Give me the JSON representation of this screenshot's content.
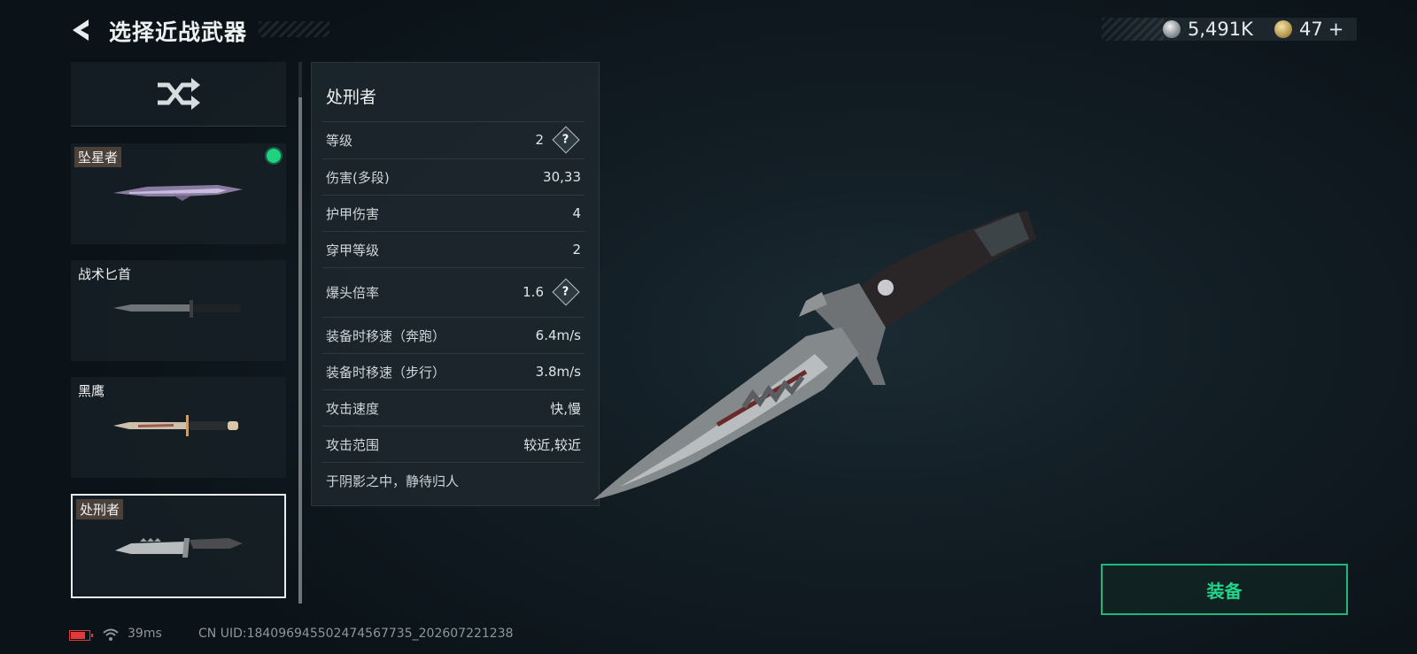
{
  "header": {
    "title": "选择近战武器"
  },
  "currency": {
    "silver_value": "5,491K",
    "gold_value": "47",
    "add_symbol": "+"
  },
  "weapon_list": {
    "items": [
      {
        "name": "坠星者",
        "equipped": true,
        "selected": false
      },
      {
        "name": "战术匕首",
        "equipped": false,
        "selected": false
      },
      {
        "name": "黑鹰",
        "equipped": false,
        "selected": false
      },
      {
        "name": "处刑者",
        "equipped": false,
        "selected": true
      }
    ]
  },
  "stats": {
    "weapon_name": "处刑者",
    "rows": [
      {
        "label": "等级",
        "value": "2",
        "help": true
      },
      {
        "label": "伤害(多段)",
        "value": "30,33",
        "help": false
      },
      {
        "label": "护甲伤害",
        "value": "4",
        "help": false
      },
      {
        "label": "穿甲等级",
        "value": "2",
        "help": false
      },
      {
        "label": "爆头倍率",
        "value": "1.6",
        "help": true
      },
      {
        "label": "装备时移速（奔跑）",
        "value": "6.4m/s",
        "help": false
      },
      {
        "label": "装备时移速（步行）",
        "value": "3.8m/s",
        "help": false
      },
      {
        "label": "攻击速度",
        "value": "快,慢",
        "help": false
      },
      {
        "label": "攻击范围",
        "value": "较近,较近",
        "help": false
      }
    ],
    "help_symbol": "?",
    "description": "于阴影之中，静待归人"
  },
  "equip_button": {
    "label": "装备"
  },
  "status_bar": {
    "battery_level": 0.8,
    "ping": "39ms",
    "uid": "CN UID:18409694550247456773​5_202607221238"
  },
  "colors": {
    "accent_green": "#1fd27f",
    "battery_red": "#e03a3a",
    "background": "#121d24"
  }
}
